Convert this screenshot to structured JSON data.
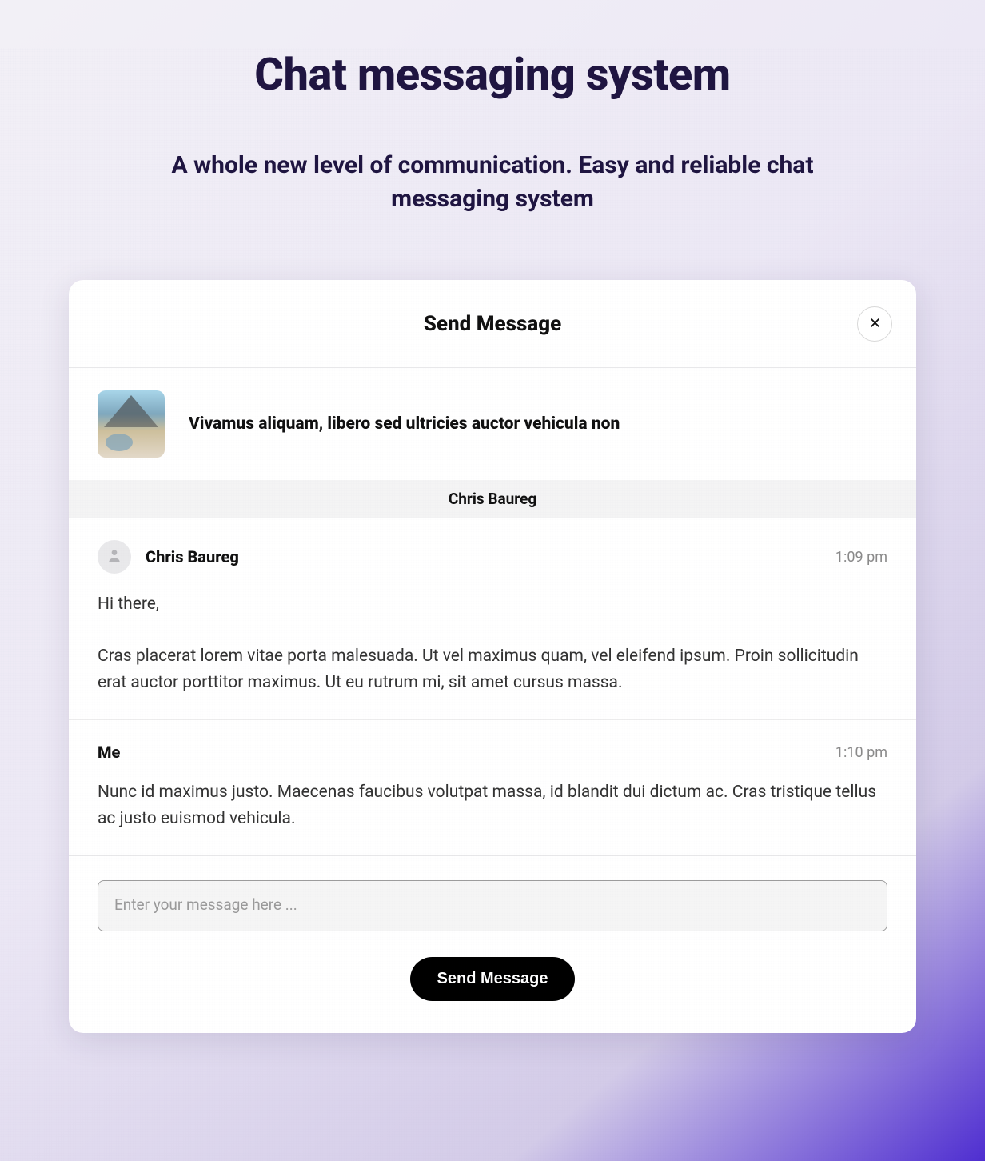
{
  "page": {
    "title": "Chat messaging system",
    "subtitle": "A whole new level of communication. Easy and reliable chat messaging system"
  },
  "modal": {
    "title": "Send Message",
    "close_icon": "close-icon",
    "listing": {
      "thumbnail": "listing-thumbnail",
      "title": "Vivamus aliquam, libero sed ultricies auctor vehicula non"
    },
    "participant": "Chris Baureg",
    "messages": [
      {
        "sender": "Chris Baureg",
        "has_avatar": true,
        "time": "1:09 pm",
        "body": "Hi there,\n\nCras placerat lorem vitae porta malesuada. Ut vel maximus quam, vel eleifend ipsum. Proin sollicitudin erat auctor porttitor maximus. Ut eu rutrum mi, sit amet cursus massa."
      },
      {
        "sender": "Me",
        "has_avatar": false,
        "time": "1:10 pm",
        "body": "Nunc id maximus justo. Maecenas faucibus volutpat massa, id blandit dui dictum ac. Cras tristique tellus ac justo euismod vehicula."
      }
    ],
    "composer": {
      "placeholder": "Enter your message here ...",
      "value": "",
      "send_label": "Send Message"
    }
  }
}
